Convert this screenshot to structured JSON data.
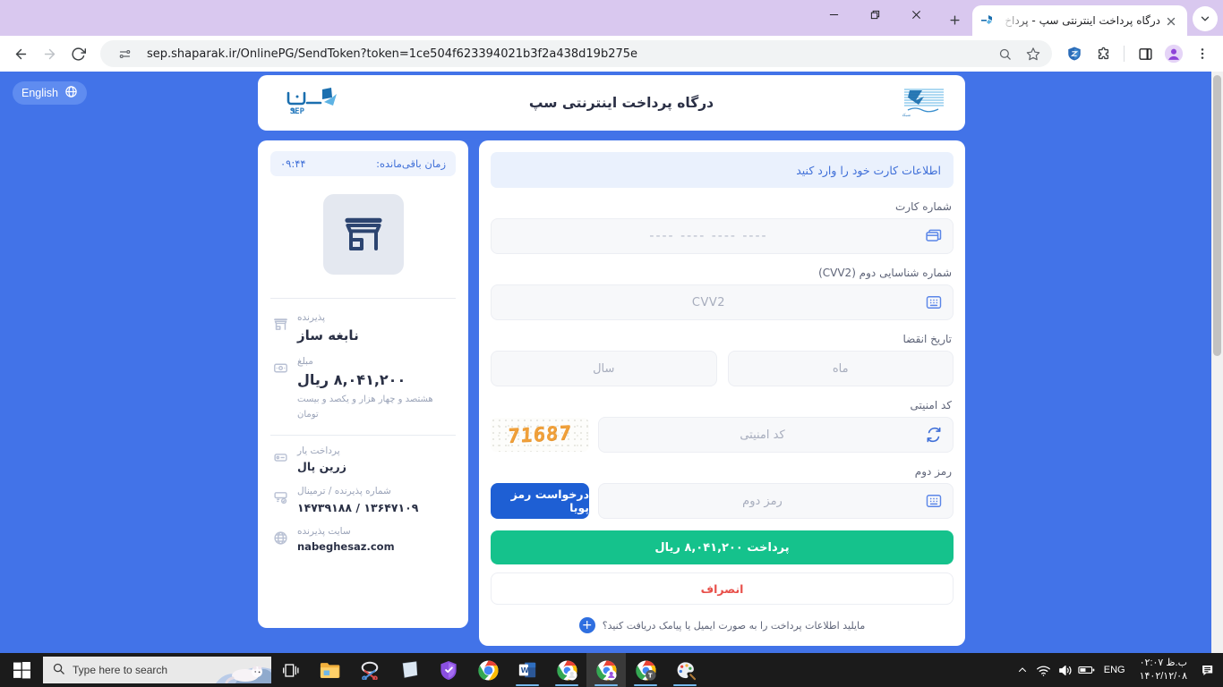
{
  "browser": {
    "tab": {
      "title": "درگاه پرداخت اینترنتی سپ - پرداخ",
      "favicon": "sep-favicon"
    },
    "new_tab_label": "+",
    "url": "sep.shaparak.ir/OnlinePG/SendToken?token=1ce504f623394021b3f2a438d19b275e",
    "window_controls": {
      "minimize": "minimize-icon",
      "restore": "restore-icon",
      "close": "close-icon"
    },
    "toolbar_icons": [
      "back-icon",
      "forward-icon",
      "reload-icon",
      "site-info-icon",
      "zoom-icon",
      "bookmark-star-icon",
      "zenmate-extension-icon",
      "extensions-icon",
      "side-panel-icon",
      "profile-avatar-icon",
      "chrome-menu-icon"
    ]
  },
  "page": {
    "lang_button": {
      "label": "English",
      "icon": "globe-icon"
    },
    "header": {
      "title": "درگاه پرداخت اینترنتی سپ",
      "left_logo": "shaparak-logo",
      "right_logo": "sep-logo",
      "right_logo_text": "SEP"
    },
    "sidebar": {
      "timer_label": "زمان باقی‌مانده:",
      "timer_value": "۰۹:۴۴",
      "merchant_logo_icon": "store-icon",
      "rows": [
        {
          "icon": "store-icon",
          "label": "پذیرنده",
          "value": "نابغه ساز",
          "sub": ""
        },
        {
          "icon": "money-icon",
          "label": "مبلغ",
          "value": "۸,۰۴۱,۲۰۰ ریال",
          "sub": "هشتصد و چهار هزار و یکصد و بیست تومان"
        },
        {
          "icon": "wallet-icon",
          "label": "پرداخت یار",
          "value": "زرین پال",
          "sub": ""
        },
        {
          "icon": "terminal-check-icon",
          "label": "شماره پذیرنده / ترمینال",
          "value": "۱۳۶۴۷۱۰۹ / ۱۴۷۳۹۱۸۸",
          "sub": ""
        },
        {
          "icon": "globe-icon",
          "label": "سایت پذیرنده",
          "value": "nabeghesaz.com",
          "sub": ""
        }
      ]
    },
    "form": {
      "banner": "اطلاعات کارت خود را وارد کنید",
      "card_number": {
        "label": "شماره کارت",
        "placeholder": "---- ---- ---- ----",
        "value": "",
        "icon": "card-icon"
      },
      "cvv2": {
        "label": "شماره شناسایی دوم (CVV2)",
        "placeholder": "CVV2",
        "value": "",
        "icon": "keypad-icon"
      },
      "expiry": {
        "label": "تاریخ انقضا",
        "month": {
          "placeholder": "ماه",
          "value": ""
        },
        "year": {
          "placeholder": "سال",
          "value": ""
        }
      },
      "captcha": {
        "label": "کد امنیتی",
        "placeholder": "کد امنیتی",
        "value": "",
        "image_text": "71687",
        "refresh_icon": "refresh-icon",
        "color": "#f0a03a"
      },
      "otp": {
        "label": "رمز دوم",
        "placeholder": "رمز دوم",
        "value": "",
        "icon": "keypad-icon",
        "button_label": "درخواست رمز پویا",
        "button_color": "#1e5fd4"
      },
      "pay_button": {
        "label": "پرداخت ۸,۰۴۱,۲۰۰ ریال",
        "color": "#15c28c"
      },
      "cancel_button": {
        "label": "انصراف",
        "color": "#e8504a"
      },
      "footnote": "مایلید اطلاعات پرداخت را به صورت ایمیل یا پیامک دریافت کنید؟"
    }
  },
  "taskbar": {
    "start_icon": "windows-start-icon",
    "search_placeholder": "Type here to search",
    "search_icon": "search-icon",
    "task_view_icon": "task-view-icon",
    "apps": [
      {
        "name": "file-explorer-icon",
        "active": false,
        "running": false
      },
      {
        "name": "snipping-tool-icon",
        "active": false,
        "running": false
      },
      {
        "name": "sticky-notes-icon",
        "active": false,
        "running": false
      },
      {
        "name": "windows-security-icon",
        "active": false,
        "running": false
      },
      {
        "name": "chrome-icon",
        "active": false,
        "running": false
      },
      {
        "name": "word-icon",
        "active": false,
        "running": true
      },
      {
        "name": "chrome-profile-icon",
        "active": false,
        "running": true
      },
      {
        "name": "chrome-profile-active-icon",
        "active": true,
        "running": true
      },
      {
        "name": "chrome-profile-t-icon",
        "active": false,
        "running": true
      },
      {
        "name": "paint-icon",
        "active": false,
        "running": true
      }
    ],
    "tray": [
      "chevron-up-icon",
      "wifi-icon",
      "volume-icon",
      "battery-icon"
    ],
    "language": "ENG",
    "time": "۰۲:۰۷ ب.ظ",
    "date": "۱۴۰۲/۱۲/۰۸",
    "notification_icon": "notification-icon"
  }
}
